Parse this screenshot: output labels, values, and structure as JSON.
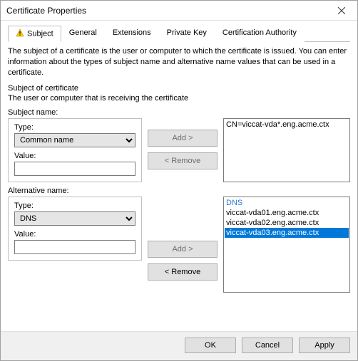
{
  "window": {
    "title": "Certificate Properties"
  },
  "tabs": {
    "subject": "Subject",
    "general": "General",
    "extensions": "Extensions",
    "private_key": "Private Key",
    "ca": "Certification Authority"
  },
  "body": {
    "description": "The subject of a certificate is the user or computer to which the certificate is issued. You can enter information about the types of subject name and alternative name values that can be used in a certificate.",
    "cert_heading": "Subject of certificate",
    "cert_sub": "The user or computer that is receiving the certificate"
  },
  "subject_name": {
    "label": "Subject name:",
    "type_label": "Type:",
    "type_value": "Common name",
    "value_label": "Value:",
    "value_value": "",
    "add": "Add >",
    "remove": "< Remove",
    "entries": [
      "CN=viccat-vda*.eng.acme.ctx"
    ]
  },
  "alt_name": {
    "label": "Alternative name:",
    "type_label": "Type:",
    "type_value": "DNS",
    "value_label": "Value:",
    "value_value": "",
    "add": "Add >",
    "remove": "< Remove",
    "group_header": "DNS",
    "entries": [
      "viccat-vda01.eng.acme.ctx",
      "viccat-vda02.eng.acme.ctx",
      "viccat-vda03.eng.acme.ctx"
    ],
    "selected_index": 2
  },
  "buttons": {
    "ok": "OK",
    "cancel": "Cancel",
    "apply": "Apply"
  }
}
